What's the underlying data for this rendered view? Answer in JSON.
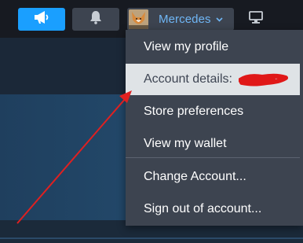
{
  "header": {
    "account_name": "Mercedes"
  },
  "menu": {
    "items": [
      {
        "label": "View my profile"
      },
      {
        "label": "Account details:"
      },
      {
        "label": "Store preferences"
      },
      {
        "label": "View my wallet"
      },
      {
        "label": "Change Account..."
      },
      {
        "label": "Sign out of account..."
      }
    ],
    "highlighted_index": 1
  },
  "icons": {
    "announce": "megaphone-icon",
    "notifications": "bell-icon",
    "dropdown": "chevron-down-icon",
    "display": "monitor-icon"
  },
  "colors": {
    "accent": "#1a9fff",
    "account_name": "#6fb6f5",
    "menu_bg": "#3d4450",
    "highlight_bg": "#dfe3e6",
    "annotation": "#e02020"
  }
}
